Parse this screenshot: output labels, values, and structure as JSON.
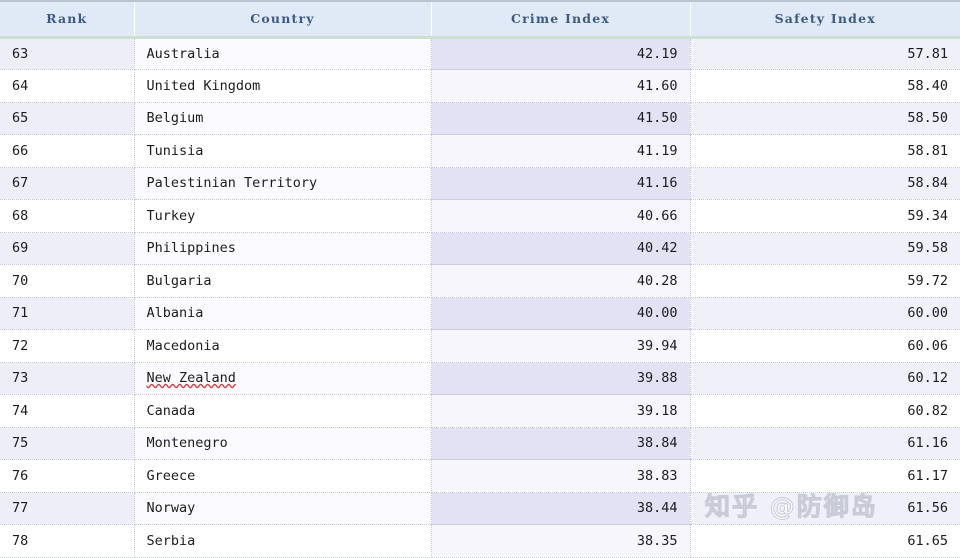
{
  "table": {
    "columns": [
      {
        "key": "rank",
        "label": "Rank",
        "align": "left"
      },
      {
        "key": "country",
        "label": "Country",
        "align": "left"
      },
      {
        "key": "crime",
        "label": "Crime Index",
        "align": "right"
      },
      {
        "key": "safety",
        "label": "Safety Index",
        "align": "right"
      }
    ],
    "rows": [
      {
        "rank": "63",
        "country": "Australia",
        "crime": "42.19",
        "safety": "57.81",
        "misspelled": false
      },
      {
        "rank": "64",
        "country": "United Kingdom",
        "crime": "41.60",
        "safety": "58.40",
        "misspelled": false
      },
      {
        "rank": "65",
        "country": "Belgium",
        "crime": "41.50",
        "safety": "58.50",
        "misspelled": false
      },
      {
        "rank": "66",
        "country": "Tunisia",
        "crime": "41.19",
        "safety": "58.81",
        "misspelled": false
      },
      {
        "rank": "67",
        "country": "Palestinian Territory",
        "crime": "41.16",
        "safety": "58.84",
        "misspelled": false
      },
      {
        "rank": "68",
        "country": "Turkey",
        "crime": "40.66",
        "safety": "59.34",
        "misspelled": false
      },
      {
        "rank": "69",
        "country": "Philippines",
        "crime": "40.42",
        "safety": "59.58",
        "misspelled": false
      },
      {
        "rank": "70",
        "country": "Bulgaria",
        "crime": "40.28",
        "safety": "59.72",
        "misspelled": false
      },
      {
        "rank": "71",
        "country": "Albania",
        "crime": "40.00",
        "safety": "60.00",
        "misspelled": false
      },
      {
        "rank": "72",
        "country": "Macedonia",
        "crime": "39.94",
        "safety": "60.06",
        "misspelled": false
      },
      {
        "rank": "73",
        "country": "New Zealand",
        "crime": "39.88",
        "safety": "60.12",
        "misspelled": true
      },
      {
        "rank": "74",
        "country": "Canada",
        "crime": "39.18",
        "safety": "60.82",
        "misspelled": false
      },
      {
        "rank": "75",
        "country": "Montenegro",
        "crime": "38.84",
        "safety": "61.16",
        "misspelled": false
      },
      {
        "rank": "76",
        "country": "Greece",
        "crime": "38.83",
        "safety": "61.17",
        "misspelled": false
      },
      {
        "rank": "77",
        "country": "Norway",
        "crime": "38.44",
        "safety": "61.56",
        "misspelled": false
      },
      {
        "rank": "78",
        "country": "Serbia",
        "crime": "38.35",
        "safety": "61.65",
        "misspelled": false
      }
    ]
  },
  "watermark": {
    "text": "知乎 @防御岛"
  },
  "colors": {
    "header_background": "#dfeaf6",
    "header_text": "#3d5a80",
    "row_shaded_rank": "#eeeef8",
    "row_shaded_crime": "#e2e2f4",
    "row_shaded_safety": "#eff0fa",
    "row_plain": "#ffffff",
    "grid_line": "#c3c9dd",
    "spell_error": "#d23b3b"
  }
}
